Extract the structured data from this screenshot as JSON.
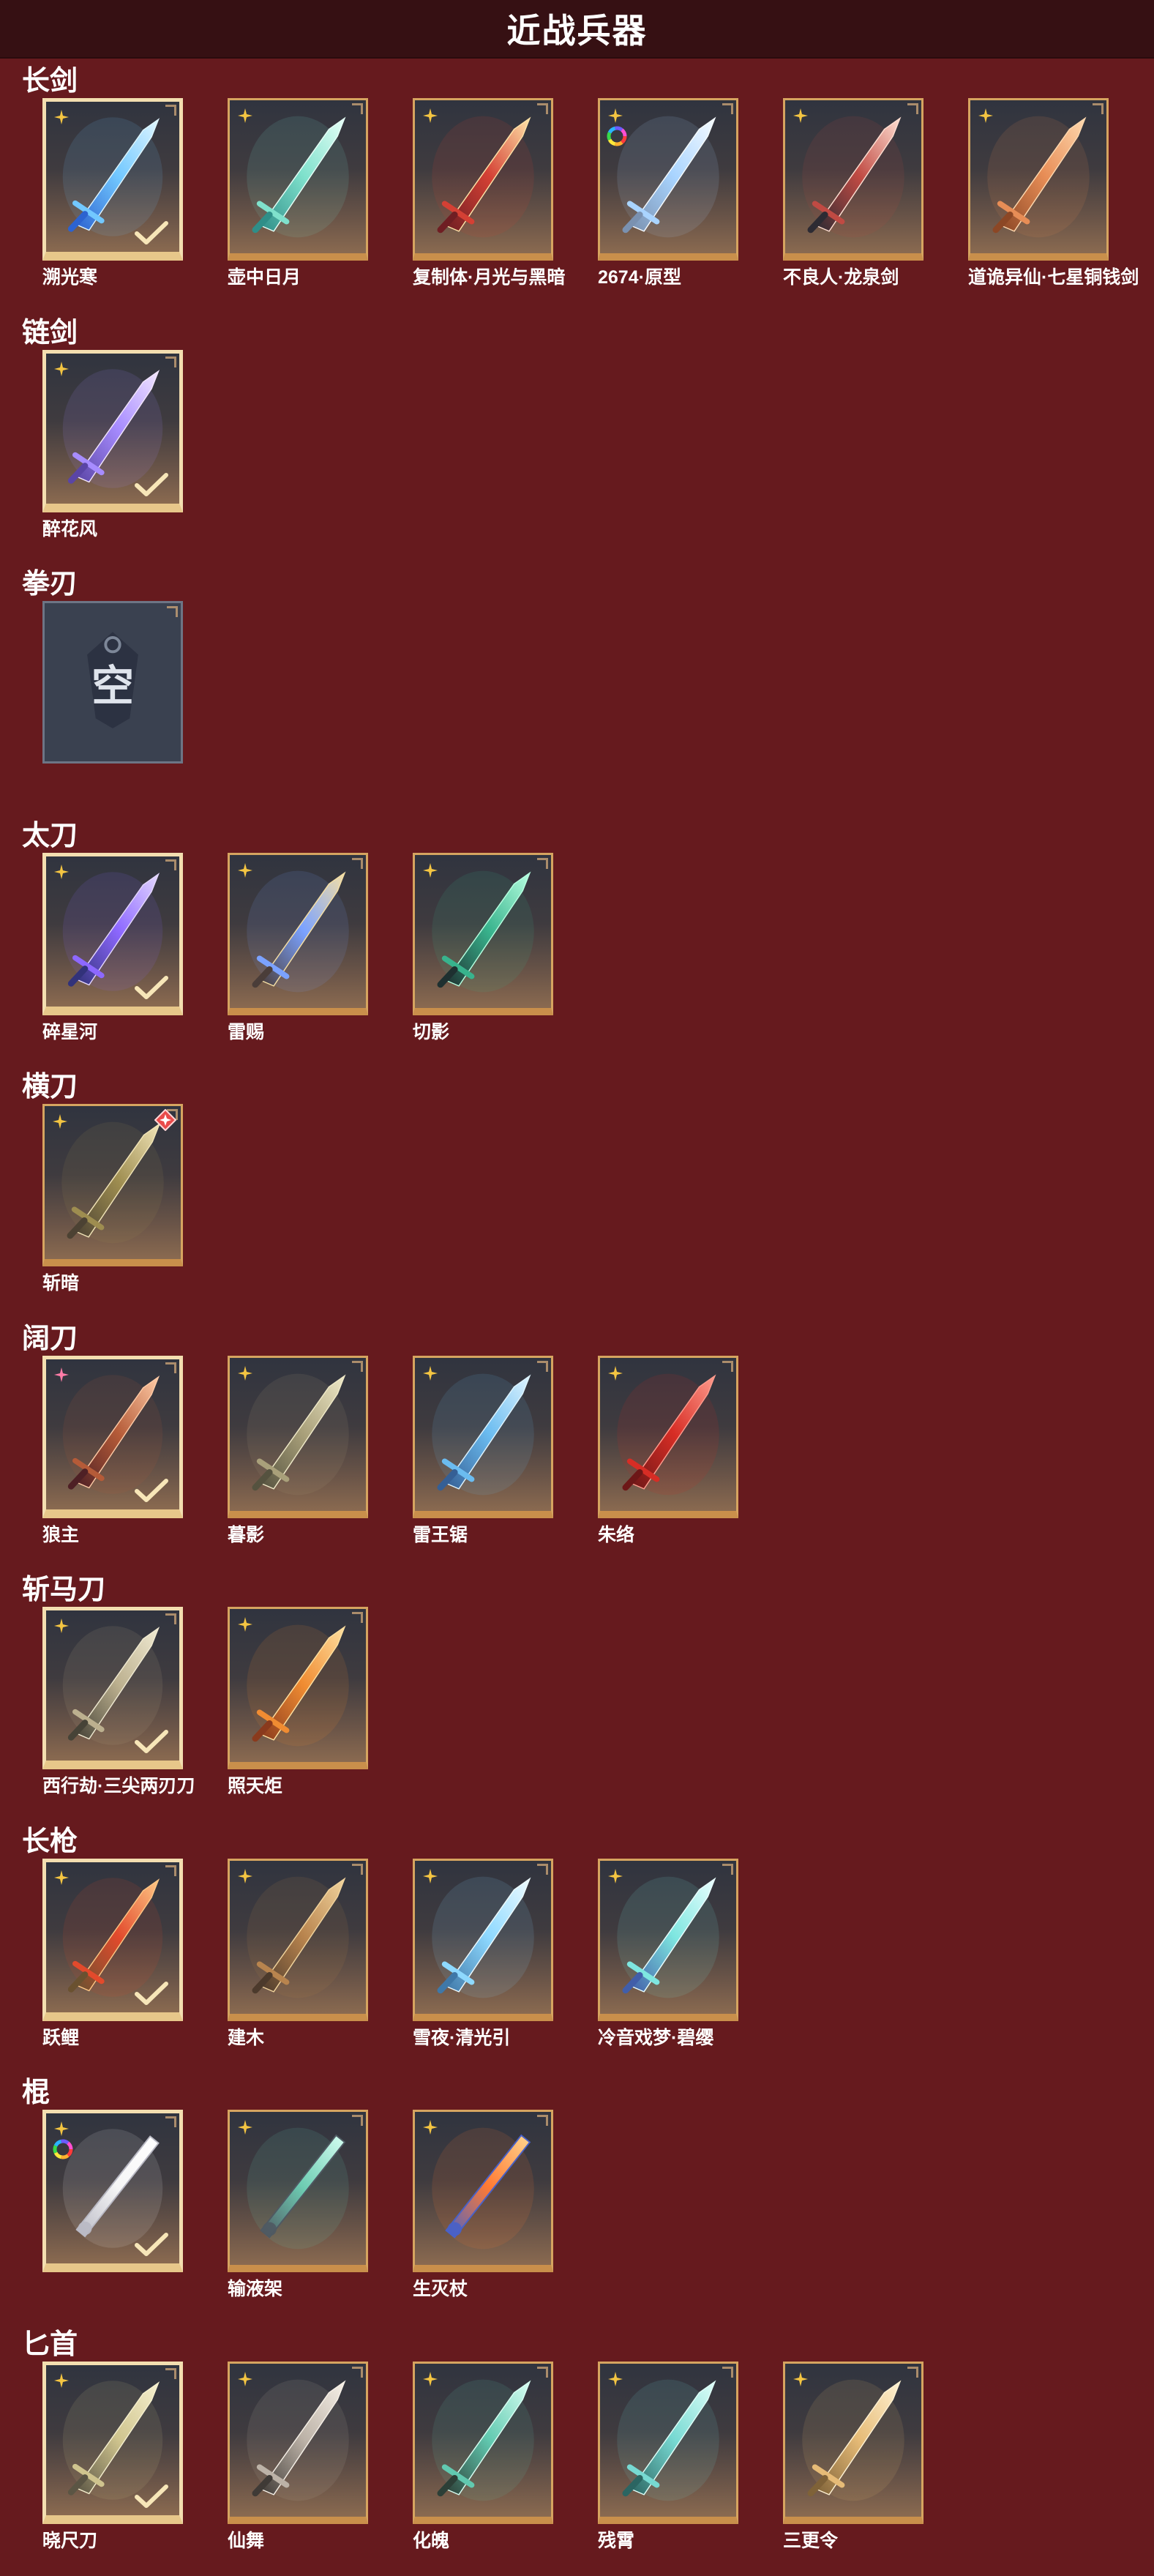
{
  "title": "近战兵器",
  "categories": [
    {
      "name": "长剑",
      "items": [
        {
          "name": "溯光寒",
          "selected": true,
          "art": "blade",
          "palette": [
            "#dff6ff",
            "#72c8ff",
            "#2c63d0"
          ]
        },
        {
          "name": "壶中日月",
          "selected": false,
          "art": "blade",
          "palette": [
            "#e6fff7",
            "#7fe1cc",
            "#2f8e88"
          ]
        },
        {
          "name": "复制体·月光与黑暗",
          "selected": false,
          "art": "blade",
          "palette": [
            "#ffe3a8",
            "#d44034",
            "#6f1e23"
          ]
        },
        {
          "name": "2674·原型",
          "selected": false,
          "special_icon": "rainbow-ring",
          "art": "blade",
          "palette": [
            "#f6fbff",
            "#a9d4ff",
            "#7a91b0"
          ]
        },
        {
          "name": "不良人·龙泉剑",
          "selected": false,
          "art": "blade",
          "palette": [
            "#ffdfd2",
            "#c04a43",
            "#2d2b33"
          ]
        },
        {
          "name": "道诡异仙·七星铜钱剑",
          "selected": false,
          "art": "blade",
          "palette": [
            "#ffd8ae",
            "#e78d56",
            "#8c4725"
          ]
        }
      ]
    },
    {
      "name": "链剑",
      "items": [
        {
          "name": "醉花风",
          "selected": true,
          "art": "blade",
          "palette": [
            "#f3e6ff",
            "#a78cff",
            "#5a45a6"
          ]
        }
      ]
    },
    {
      "name": "拳刃",
      "items": [
        {
          "name": "",
          "selected": false,
          "empty": true,
          "empty_label": "空"
        }
      ]
    },
    {
      "name": "太刀",
      "items": [
        {
          "name": "碎星河",
          "selected": true,
          "art": "blade",
          "palette": [
            "#e4d7ff",
            "#8d68ff",
            "#32327a"
          ]
        },
        {
          "name": "雷赐",
          "selected": false,
          "art": "blade",
          "palette": [
            "#f5dfa5",
            "#7ba2ff",
            "#4a3d39"
          ]
        },
        {
          "name": "切影",
          "selected": false,
          "art": "blade",
          "palette": [
            "#b6ffe0",
            "#38b38d",
            "#1e3030"
          ]
        }
      ]
    },
    {
      "name": "横刀",
      "items": [
        {
          "name": "斩暗",
          "selected": false,
          "badge": "red-diamond",
          "art": "blade",
          "palette": [
            "#f1e4b7",
            "#9e8d50",
            "#4c4233"
          ]
        }
      ]
    },
    {
      "name": "阔刀",
      "items": [
        {
          "name": "狼主",
          "selected": true,
          "quality": "pink",
          "art": "blade",
          "palette": [
            "#ffcba6",
            "#b55b38",
            "#4e2025"
          ]
        },
        {
          "name": "暮影",
          "selected": false,
          "art": "blade",
          "palette": [
            "#efe9c8",
            "#a9a07a",
            "#55523f"
          ]
        },
        {
          "name": "雷王锯",
          "selected": false,
          "art": "blade",
          "palette": [
            "#def4ff",
            "#6bbcf0",
            "#355f95"
          ]
        },
        {
          "name": "朱络",
          "selected": false,
          "art": "blade",
          "palette": [
            "#ff9b8d",
            "#d72d25",
            "#6d1717"
          ]
        }
      ]
    },
    {
      "name": "斩马刀",
      "items": [
        {
          "name": "西行劫·三尖两刃刀",
          "selected": true,
          "art": "blade",
          "palette": [
            "#f0ead2",
            "#bcb08f",
            "#464337"
          ]
        },
        {
          "name": "照天炬",
          "selected": false,
          "art": "blade",
          "palette": [
            "#ffe0a0",
            "#f08c32",
            "#8a3a1d"
          ]
        }
      ]
    },
    {
      "name": "长枪",
      "items": [
        {
          "name": "跃鲤",
          "selected": true,
          "art": "blade",
          "palette": [
            "#ffc785",
            "#e24a2c",
            "#6a5130"
          ]
        },
        {
          "name": "建木",
          "selected": false,
          "art": "blade",
          "palette": [
            "#f2d49d",
            "#b8844e",
            "#4c3a2c"
          ]
        },
        {
          "name": "雪夜·清光引",
          "selected": false,
          "art": "blade",
          "palette": [
            "#eefbff",
            "#8ed9ff",
            "#3f78a8"
          ]
        },
        {
          "name": "冷音戏梦·碧缨",
          "selected": false,
          "art": "blade",
          "palette": [
            "#eaffff",
            "#7ee6e0",
            "#415ea9"
          ]
        }
      ]
    },
    {
      "name": "棍",
      "items": [
        {
          "name": "",
          "selected": true,
          "special_icon": "rainbow-ring",
          "art": "rod",
          "palette": [
            "#ffffff",
            "#f6f6f6",
            "#b9b9c4"
          ]
        },
        {
          "name": "输液架",
          "selected": false,
          "art": "rod",
          "palette": [
            "#d5fff2",
            "#6ecdb3",
            "#4f5962"
          ]
        },
        {
          "name": "生灭杖",
          "selected": false,
          "art": "rod",
          "palette": [
            "#ffd68f",
            "#ff7a33",
            "#4861c8"
          ]
        }
      ]
    },
    {
      "name": "匕首",
      "items": [
        {
          "name": "晓尺刀",
          "selected": true,
          "art": "blade",
          "palette": [
            "#f6f0cf",
            "#cfc48e",
            "#5b5544"
          ]
        },
        {
          "name": "仙舞",
          "selected": false,
          "art": "blade",
          "palette": [
            "#f6f0e7",
            "#bcb2a7",
            "#3f3a36"
          ]
        },
        {
          "name": "化魄",
          "selected": false,
          "art": "blade",
          "palette": [
            "#d8fff3",
            "#61c9b0",
            "#2c3f37"
          ]
        },
        {
          "name": "残霄",
          "selected": false,
          "art": "blade",
          "palette": [
            "#dffff9",
            "#77d9d2",
            "#2b6562"
          ]
        },
        {
          "name": "三更令",
          "selected": false,
          "art": "blade",
          "palette": [
            "#fff2d3",
            "#e6bb77",
            "#7f6238"
          ]
        }
      ]
    }
  ]
}
